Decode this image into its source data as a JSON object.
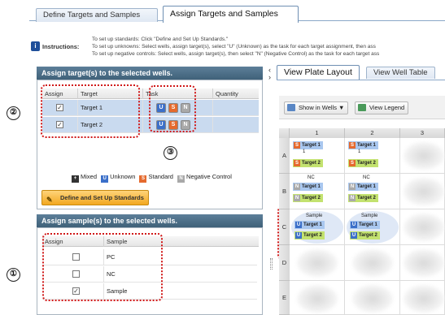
{
  "tabs": [
    {
      "label": "Define Targets and Samples",
      "active": false
    },
    {
      "label": "Assign Targets and Samples",
      "active": true
    }
  ],
  "instructions": {
    "label": "Instructions:",
    "lines": [
      "To set up standards: Click \"Define and Set Up Standards.\"",
      "To set up unknowns: Select wells, assign target(s), select \"U\" (Unknown) as the task for each target assignment, then ass",
      "To set up negative controls: Select wells, assign target(s), then select \"N\" (Negative Control) as the task for each target ass"
    ]
  },
  "assign_targets": {
    "title": "Assign target(s) to the selected wells.",
    "columns": [
      "Assign",
      "Target",
      "Task",
      "Quantity"
    ],
    "rows": [
      {
        "checked": true,
        "target": "Target 1",
        "tasks": [
          "U",
          "S",
          "N"
        ],
        "quantity": ""
      },
      {
        "checked": true,
        "target": "Target 2",
        "tasks": [
          "U",
          "S",
          "N"
        ],
        "quantity": ""
      }
    ],
    "legend": [
      {
        "icon": "mixed-icon",
        "label": "Mixed",
        "color": "#333333"
      },
      {
        "icon": "unknown-icon",
        "label": "Unknown",
        "color": "#3b6fc9"
      },
      {
        "icon": "standard-icon",
        "label": "Standard",
        "color": "#e56a2e"
      },
      {
        "icon": "negative-control-icon",
        "label": "Negative Control",
        "color": "#a9a9a9"
      }
    ],
    "define_button": "Define and Set Up Standards"
  },
  "assign_samples": {
    "title": "Assign sample(s) to the selected wells.",
    "columns": [
      "Assign",
      "Sample"
    ],
    "rows": [
      {
        "checked": false,
        "sample": "PC"
      },
      {
        "checked": false,
        "sample": "NC"
      },
      {
        "checked": true,
        "sample": "Sample"
      }
    ]
  },
  "annotations": {
    "one": "①",
    "two": "②",
    "three": "③"
  },
  "right_tabs": [
    {
      "label": "View Plate Layout",
      "active": true
    },
    {
      "label": "View Well Table",
      "active": false
    }
  ],
  "toolbar": {
    "show_in_wells": "Show in Wells ▼",
    "view_legend": "View Legend"
  },
  "plate": {
    "columns": [
      "1",
      "2",
      "3"
    ],
    "rows": [
      "A",
      "B",
      "C",
      "D",
      "E"
    ],
    "wells": {
      "A1": {
        "sample": "",
        "chips": [
          {
            "task": "S",
            "label": "Target 1",
            "extra": "1"
          },
          {
            "task": "S",
            "label": "Target 2"
          }
        ]
      },
      "A2": {
        "sample": "",
        "chips": [
          {
            "task": "S",
            "label": "Target 1",
            "extra": "1"
          },
          {
            "task": "S",
            "label": "Target 2"
          }
        ]
      },
      "B1": {
        "sample": "NC",
        "chips": [
          {
            "task": "N",
            "label": "Target 1"
          },
          {
            "task": "N",
            "label": "Target 2"
          }
        ]
      },
      "B2": {
        "sample": "NC",
        "chips": [
          {
            "task": "N",
            "label": "Target 1"
          },
          {
            "task": "N",
            "label": "Target 2"
          }
        ]
      },
      "C1": {
        "sample": "Sample",
        "chips": [
          {
            "task": "U",
            "label": "Target 1"
          },
          {
            "task": "U",
            "label": "Target 2"
          }
        ]
      },
      "C2": {
        "sample": "Sample",
        "chips": [
          {
            "task": "U",
            "label": "Target 1"
          },
          {
            "task": "U",
            "label": "Target 2"
          }
        ]
      }
    }
  },
  "colors": {
    "unknown": "#3b6fc9",
    "standard": "#e56a2e",
    "negative": "#a9a9a9",
    "highlight": "#d01818"
  }
}
